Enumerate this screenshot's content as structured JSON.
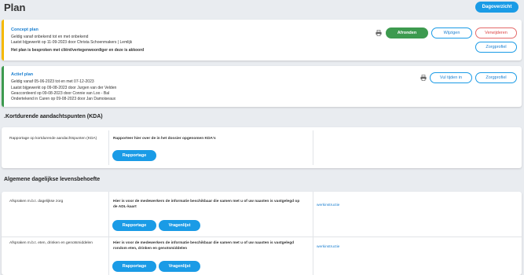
{
  "header": {
    "title": "Plan",
    "overview_label": "Dagoverzicht"
  },
  "concept_plan": {
    "title": "Concept plan",
    "lines": [
      "Geldig vanaf onbekend tot en met onbekend",
      "Laatst bijgewerkt op 11-09-2023 door Christa Schoenmakers | Lemlijk",
      "Het plan is besproken met cliënt/vertegenwoordiger en deze is akkoord"
    ],
    "buttons": {
      "finish": "Afronden",
      "edit": "Wijzigen",
      "delete": "Verwijderen",
      "care_profile": "Zorgprofiel"
    }
  },
  "active_plan": {
    "title": "Actief plan",
    "lines": [
      "Geldig vanaf 05-06-2023 tot en met 07-12-2023",
      "Laatst bijgewerkt op 09-08-2023 door Jurgen van der Velden",
      "Geaccordeerd op 09-08-2023 door Connie van Loo - Bal",
      "Ondertekend in Caren op 09-08-2023 door Jan Damoiseaux"
    ],
    "buttons": {
      "fill_times": "Vul tijden in",
      "care_profile": "Zorgprofiel"
    }
  },
  "kda": {
    "heading": ".Kortdurende aandachtspunten (KDA)",
    "row": {
      "label": "Rapportage op kortdurende aandachtspunten (KDA)",
      "text": "Rapporteer hier over de in het dossier opgenomen KDA's",
      "button": "Rapportage"
    }
  },
  "adl": {
    "heading": "Algemene dagelijkse levensbehoefte",
    "rows": [
      {
        "label": "Afspraken m.b.t. dagelijkse zorg",
        "text": "Hier is voor de medewerkers de informatie beschikbaar die samen met u of uw naasten is vastgelegd op de ADL-kaart",
        "report_button": "Rapportage",
        "questions_button": "Vragenlijst",
        "link": "werkinstructie"
      },
      {
        "label": "Afspraken m.b.t. eten, drinken en genotsmiddelen",
        "text": "Hier is voor de medewerkers de informatie beschikbaar die samen met u of uw naasten is vastgelegd rondom eten, drinken en genotsmiddelen",
        "report_button": "Rapportage",
        "questions_button": "Vragenlijst",
        "link": "werkinstructie"
      }
    ]
  },
  "colors": {
    "primary": "#1a9be6",
    "concept_stripe": "#f5b800",
    "active_stripe": "#3d9a4f",
    "finish": "#3d9a4f",
    "delete": "#e46a6a"
  },
  "icons": {
    "print": "printer-icon"
  }
}
